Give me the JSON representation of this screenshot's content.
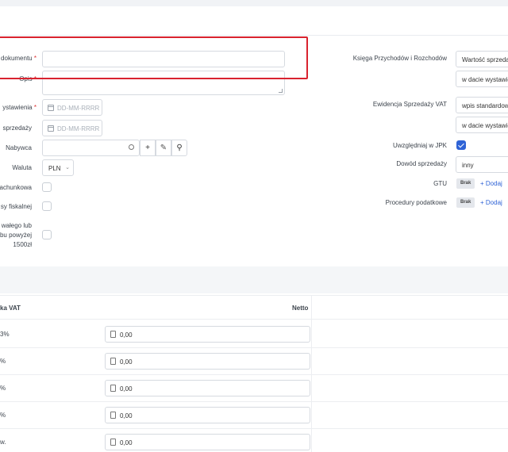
{
  "left_form": {
    "doc_label": "dokumentu",
    "doc_value": "",
    "desc_label": "Opis",
    "issue_date_label": "ystawienia",
    "issue_date_placeholder": "DD-MM-RRRR",
    "sale_date_label": "sprzedaży",
    "sale_date_placeholder": "DD-MM-RRRR",
    "buyer_label": "Nabywca",
    "buyer_value": "",
    "currency_label": "Waluta",
    "currency_value": "PLN",
    "row_a_label": "achunkowa",
    "row_b_label": "sy fiskalnej",
    "row_c_label_1": "wałego lub",
    "row_c_label_2": "bu powyżej",
    "row_c_label_3": "1500zł",
    "required_mark": "*",
    "add_symbol": "+",
    "edit_symbol": "✎",
    "search_symbol": "⚲"
  },
  "right_form": {
    "ledger_label": "Księga Przychodów i Rozchodów",
    "ledger_select_1": "Wartość sprzedaży",
    "ledger_select_2": "w dacie wystawienia",
    "vat_label": "Ewidencja Sprzedaży VAT",
    "vat_select_1": "wpis standardowy",
    "vat_select_2": "w dacie wystawienia",
    "jpk_label": "Uwzględniaj w JPK",
    "jpk_checked": true,
    "proof_label": "Dowód sprzedaży",
    "proof_value": "inny",
    "gtu_label": "GTU",
    "gtu_badge": "Brak",
    "gtu_add": "+ Dodaj",
    "procedures_label": "Procedury podatkowe",
    "procedures_badge": "Brak",
    "procedures_add": "+ Dodaj"
  },
  "table": {
    "col_vat": "ka VAT",
    "col_net": "Netto",
    "rows": [
      {
        "label": "3%",
        "value": "0,00"
      },
      {
        "label": "%",
        "value": "0,00"
      },
      {
        "label": "%",
        "value": "0,00"
      },
      {
        "label": "%",
        "value": "0,00"
      },
      {
        "label": "w.",
        "value": "0,00"
      }
    ]
  },
  "colors": {
    "accent": "#2f63d6",
    "highlight": "#d9232f"
  }
}
